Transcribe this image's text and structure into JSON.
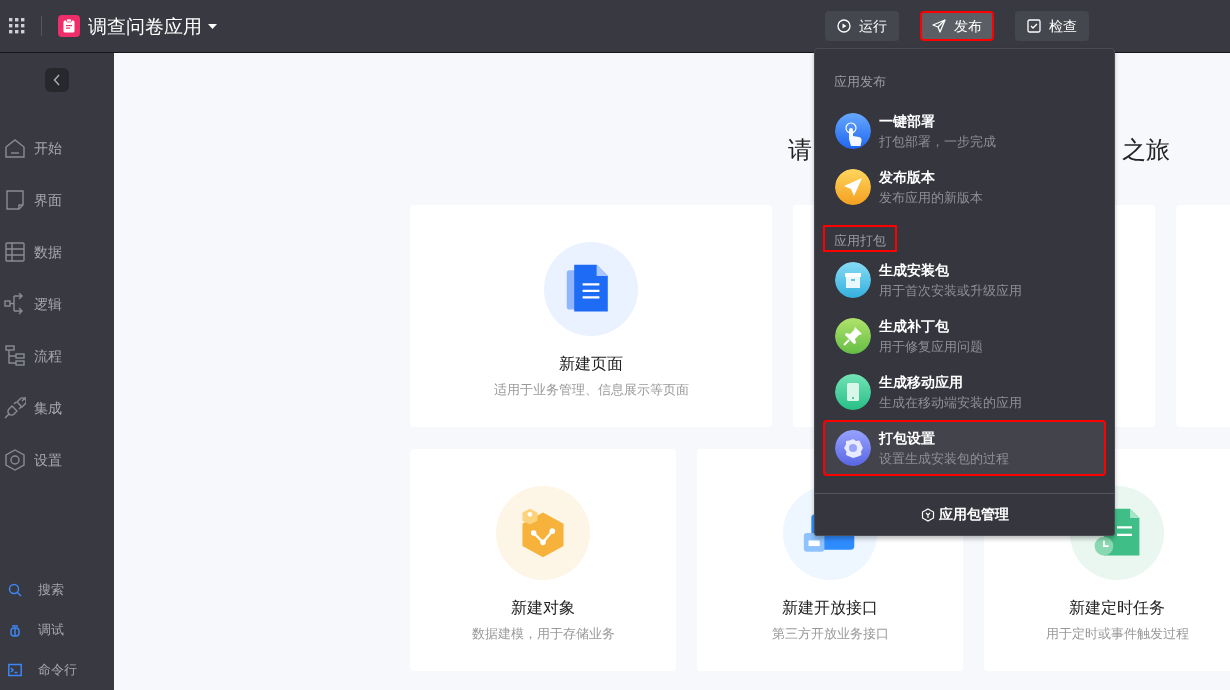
{
  "topbar": {
    "app_title": "调查问卷应用",
    "buttons": [
      {
        "label": "运行",
        "kind": "run",
        "selected": false,
        "highlighted": false
      },
      {
        "label": "发布",
        "kind": "publish",
        "selected": true,
        "highlighted": true
      },
      {
        "label": "检查",
        "kind": "check",
        "selected": false,
        "highlighted": false
      }
    ]
  },
  "sidebar": {
    "items": [
      {
        "label": "开始",
        "kind": "home"
      },
      {
        "label": "界面",
        "kind": "page"
      },
      {
        "label": "数据",
        "kind": "table"
      },
      {
        "label": "逻辑",
        "kind": "logic"
      },
      {
        "label": "流程",
        "kind": "flow"
      },
      {
        "label": "集成",
        "kind": "plug"
      },
      {
        "label": "设置",
        "kind": "settings"
      }
    ],
    "tools": [
      {
        "label": "搜索",
        "kind": "search"
      },
      {
        "label": "调试",
        "kind": "debug"
      },
      {
        "label": "命令行",
        "kind": "terminal"
      }
    ]
  },
  "main": {
    "heading_start": "请",
    "heading_end": "之旅",
    "card_rows": [
      [
        {
          "kind": "page",
          "title": "新建页面",
          "description": "适用于业务管理、信息展示等页面"
        },
        {
          "kind": "empty"
        },
        {
          "kind": "empty"
        }
      ],
      [
        {
          "kind": "object",
          "title": "新建对象",
          "description": "数据建模，用于存储业务"
        },
        {
          "kind": "api",
          "title": "新建开放接口",
          "description": "第三方开放业务接口"
        },
        {
          "kind": "timer",
          "title": "新建定时任务",
          "description": "用于定时或事件触发过程"
        }
      ]
    ]
  },
  "publish_menu": {
    "sections": [
      {
        "title": "应用发布",
        "highlighted": false,
        "items": [
          {
            "kind": "deploy",
            "title": "一键部署",
            "description": "打包部署，一步完成",
            "selected": false,
            "highlighted": false
          },
          {
            "kind": "publish",
            "title": "发布版本",
            "description": "发布应用的新版本",
            "selected": false,
            "highlighted": false
          }
        ]
      },
      {
        "title": "应用打包",
        "highlighted": true,
        "items": [
          {
            "kind": "install",
            "title": "生成安装包",
            "description": "用于首次安装或升级应用",
            "selected": false,
            "highlighted": false
          },
          {
            "kind": "patch",
            "title": "生成补丁包",
            "description": "用于修复应用问题",
            "selected": false,
            "highlighted": false
          },
          {
            "kind": "mobile",
            "title": "生成移动应用",
            "description": "生成在移动端安装的应用",
            "selected": false,
            "highlighted": false
          },
          {
            "kind": "settings",
            "title": "打包设置",
            "description": "设置生成安装包的过程",
            "selected": true,
            "highlighted": true
          }
        ]
      }
    ],
    "footer": "应用包管理"
  }
}
